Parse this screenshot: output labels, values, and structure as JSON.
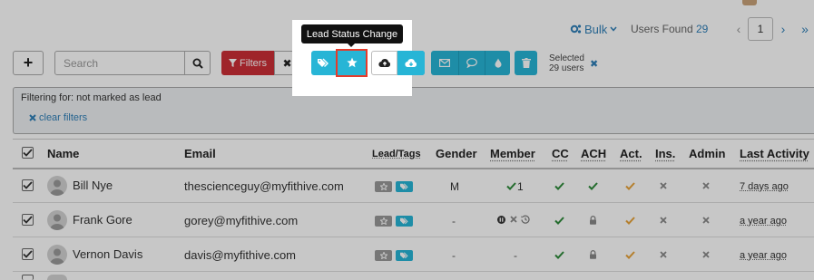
{
  "header": {
    "bulk_label": "Bulk",
    "users_found_label": "Users Found",
    "users_found_count": "29",
    "pagination": {
      "prev": "‹",
      "page": "1",
      "next": "›",
      "last": "»"
    }
  },
  "toolbar": {
    "add_label": "+",
    "search_placeholder": "Search",
    "filters_label": "Filters",
    "clear_label": "✖",
    "tooltip": "Lead Status Change",
    "selected_label": "Selected",
    "selected_count": "29 users",
    "selected_clear": "✖"
  },
  "filter_panel": {
    "filtering_text": "Filtering for: not marked as lead",
    "clear_filters": "clear filters"
  },
  "table": {
    "columns": [
      "Name",
      "Email",
      "Lead/Tags",
      "Gender",
      "Member",
      "CC",
      "ACH",
      "Act.",
      "Ins.",
      "Admin",
      "Last Activity"
    ],
    "rows": [
      {
        "name": "Bill Nye",
        "email": "thescienceguy@myfithive.com",
        "gender": "M",
        "member": "1",
        "last_activity": "7 days ago"
      },
      {
        "name": "Frank Gore",
        "email": "gorey@myfithive.com",
        "gender": "-",
        "member": "",
        "last_activity": "a year ago"
      },
      {
        "name": "Vernon Davis",
        "email": "davis@myfithive.com",
        "gender": "-",
        "member": "",
        "last_activity": "a year ago"
      }
    ]
  },
  "colors": {
    "accent": "#27b5d6",
    "danger": "#cc2f36",
    "link": "#2f7fb8",
    "check_green": "#2e8b3a",
    "check_orange": "#e8a33a"
  },
  "icons": [
    "cogs-icon",
    "chevron-down-icon",
    "plus-icon",
    "search-icon",
    "filter-icon",
    "close-icon",
    "tag-icon",
    "star-icon",
    "cloud-upload-icon",
    "cloud-download-icon",
    "envelope-icon",
    "comment-icon",
    "tint-icon",
    "trash-icon",
    "checkbox-checked-icon",
    "user-avatar-icon",
    "check-icon",
    "times-icon",
    "lock-icon",
    "pause-icon",
    "history-icon"
  ]
}
